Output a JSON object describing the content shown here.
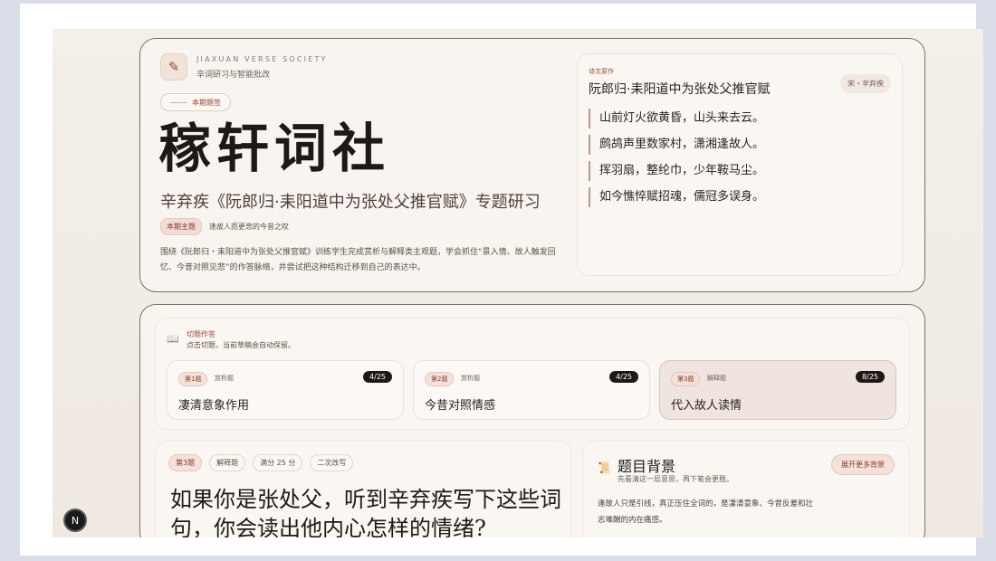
{
  "brand": {
    "en": "JIAXUAN VERSE SOCIETY",
    "cn": "辛词研习与智能批改",
    "issue_label": "本期题签",
    "title": "稼轩词社",
    "subtitle": "辛弃疾《阮郎归·耒阳道中为张处父推官赋》专题研习",
    "theme_tag": "本期主题",
    "theme_text": "逢故人而更悲的今昔之叹",
    "description": "围绕《阮郎归・耒阳道中为张处父推官赋》训练学生完成赏析与解释类主观题，学会抓住“景入情、故人触发回忆、今昔对照见悲”的作答脉络，并尝试把这种结构迁移到自己的表达中。"
  },
  "poem": {
    "label": "诗文原作",
    "title": "阮郎归·耒阳道中为张处父推官赋",
    "author": "宋・辛弃疾",
    "lines": [
      "山前灯火欲黄昏，山头来去云。",
      "鹧鸪声里数家村，潇湘逢故人。",
      "挥羽扇，整纶巾，少年鞍马尘。",
      "如今憔悴赋招魂，儒冠多误身。"
    ]
  },
  "question_panel": {
    "title": "切题作答",
    "subtitle": "点击切题，当前草稿会自动保留。",
    "tabs": [
      {
        "num": "第1题",
        "kind": "赏析题",
        "score": "4/25",
        "name": "凄清意象作用",
        "active": false
      },
      {
        "num": "第2题",
        "kind": "赏析题",
        "score": "4/25",
        "name": "今昔对照情感",
        "active": false
      },
      {
        "num": "第3题",
        "kind": "解释题",
        "score": "8/25",
        "name": "代入故人读情",
        "active": true
      }
    ]
  },
  "question_detail": {
    "num": "第3题",
    "kind": "解释题",
    "full_score": "满分 25 分",
    "revision": "二次改写",
    "text": "如果你是张处父，听到辛弃疾写下这些词句，你会读出他内心怎样的情绪?"
  },
  "background": {
    "title": "题目背景",
    "subtitle": "先看清这一层意思，再下笔会更稳。",
    "button": "展开更多背景",
    "text": "逢故人只是引线，真正压住全词的，是凄清意象、今昔反差和壮志难酬的内在痛感。"
  },
  "badge": "N"
}
